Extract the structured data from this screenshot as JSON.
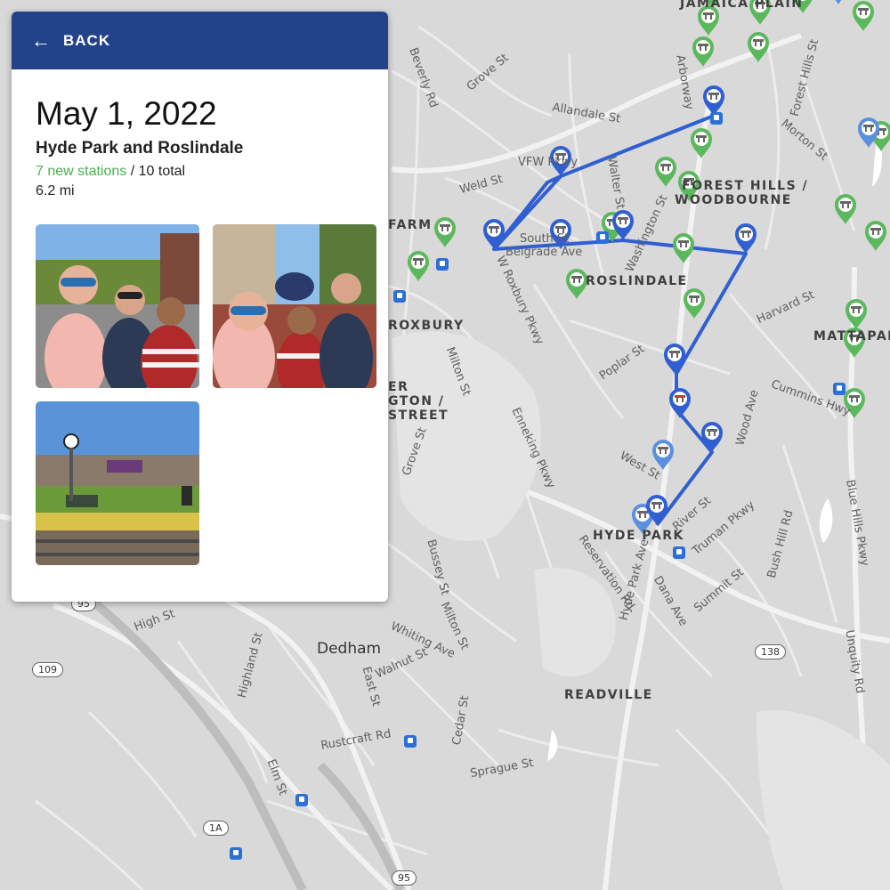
{
  "panel": {
    "back_label": "BACK",
    "trip_date": "May 1, 2022",
    "trip_title": "Hyde Park and Roslindale",
    "new_stations": "7 new stations",
    "total_stations": "/ 10 total",
    "distance": "6.2 mi"
  },
  "map": {
    "area_labels": [
      "JAMAICA PLAIN",
      "FOREST HILLS /",
      "WOODBOURNE",
      "ROSLINDALE",
      "ROXBURY",
      "HYDE PARK",
      "READVILLE",
      "MATTAPAN",
      "FARM",
      "ER",
      "GTON /",
      "STREET"
    ],
    "town_labels": [
      "Dedham"
    ],
    "street_labels": [
      "Grove St",
      "Allandale St",
      "VFW Pkwy",
      "Weld St",
      "Walter St",
      "South St",
      "Belgrade Ave",
      "Washington St",
      "Arborway",
      "Forest Hills St",
      "Morton St",
      "W Roxbury Pkwy",
      "Poplar St",
      "Harvard St",
      "Cummins Hwy",
      "Wood Ave",
      "West St",
      "River St",
      "Truman Pkwy",
      "Enneking Pkwy",
      "Reservation Rd",
      "Hyde Park Ave",
      "Dana Ave",
      "Summit St",
      "Bush Hill Rd",
      "Blue Hills Pkwy",
      "Unquity Rd",
      "High St",
      "Highland St",
      "Whiting Ave",
      "Walnut St",
      "Bussey St",
      "Milton St",
      "East St",
      "Cedar St",
      "Rustcraft Rd",
      "Sprague St",
      "Elm St",
      "Beverly Rd",
      "Grove St",
      "Milton St"
    ],
    "route_shields": [
      "109",
      "138",
      "1A",
      "95",
      "95"
    ]
  },
  "colors": {
    "header": "#22428a",
    "route": "#2f5fd0",
    "visited_pin": "#2f5fd0",
    "unvisited_pin": "#5cb85c",
    "new_stations": "#4caf50"
  }
}
